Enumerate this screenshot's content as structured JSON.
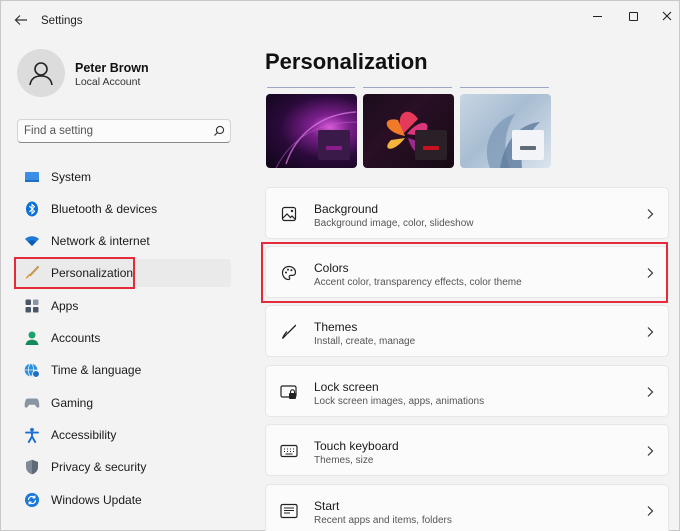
{
  "window": {
    "title": "Settings"
  },
  "profile": {
    "name": "Peter Brown",
    "account_type": "Local Account"
  },
  "search": {
    "placeholder": "Find a setting"
  },
  "sidebar": {
    "items": [
      {
        "label": "System",
        "icon": "monitor-icon",
        "active": false
      },
      {
        "label": "Bluetooth & devices",
        "icon": "bluetooth-icon",
        "active": false
      },
      {
        "label": "Network & internet",
        "icon": "wifi-icon",
        "active": false
      },
      {
        "label": "Personalization",
        "icon": "paintbrush-icon",
        "active": true
      },
      {
        "label": "Apps",
        "icon": "apps-icon",
        "active": false
      },
      {
        "label": "Accounts",
        "icon": "person-icon",
        "active": false
      },
      {
        "label": "Time & language",
        "icon": "globe-clock-icon",
        "active": false
      },
      {
        "label": "Gaming",
        "icon": "gamepad-icon",
        "active": false
      },
      {
        "label": "Accessibility",
        "icon": "accessibility-icon",
        "active": false
      },
      {
        "label": "Privacy & security",
        "icon": "shield-icon",
        "active": false
      },
      {
        "label": "Windows Update",
        "icon": "update-icon",
        "active": false
      }
    ]
  },
  "main": {
    "title": "Personalization",
    "cards": [
      {
        "title": "Background",
        "description": "Background image, color, slideshow",
        "icon": "image-icon"
      },
      {
        "title": "Colors",
        "description": "Accent color, transparency effects, color theme",
        "icon": "palette-icon"
      },
      {
        "title": "Themes",
        "description": "Install, create, manage",
        "icon": "brush-icon"
      },
      {
        "title": "Lock screen",
        "description": "Lock screen images, apps, animations",
        "icon": "lock-screen-icon"
      },
      {
        "title": "Touch keyboard",
        "description": "Themes, size",
        "icon": "keyboard-icon"
      },
      {
        "title": "Start",
        "description": "Recent apps and items, folders",
        "icon": "start-icon"
      }
    ]
  },
  "colors": {
    "highlight": "#e52b3b",
    "accent_blue": "#0067c0",
    "thumb_1_accent": "#8a1d8c",
    "thumb_2_accent": "#c8101e",
    "thumb_3_accent": "#5f6b78"
  }
}
